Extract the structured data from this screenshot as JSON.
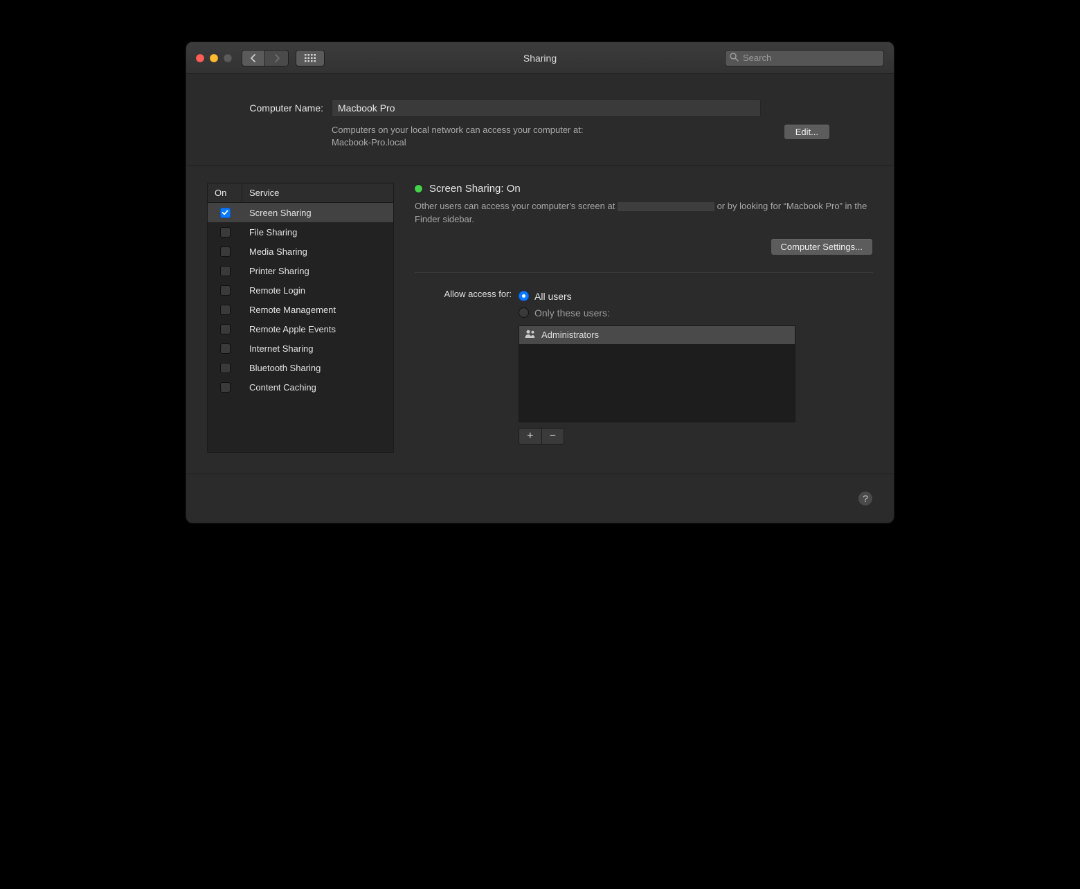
{
  "window": {
    "title": "Sharing",
    "search_placeholder": "Search"
  },
  "computer_name": {
    "label": "Computer Name:",
    "value": "Macbook Pro",
    "description_line1": "Computers on your local network can access your computer at:",
    "description_line2": "Macbook-Pro.local",
    "edit_label": "Edit..."
  },
  "services": {
    "header_on": "On",
    "header_service": "Service",
    "items": [
      {
        "name": "Screen Sharing",
        "on": true,
        "selected": true
      },
      {
        "name": "File Sharing",
        "on": false,
        "selected": false
      },
      {
        "name": "Media Sharing",
        "on": false,
        "selected": false
      },
      {
        "name": "Printer Sharing",
        "on": false,
        "selected": false
      },
      {
        "name": "Remote Login",
        "on": false,
        "selected": false
      },
      {
        "name": "Remote Management",
        "on": false,
        "selected": false
      },
      {
        "name": "Remote Apple Events",
        "on": false,
        "selected": false
      },
      {
        "name": "Internet Sharing",
        "on": false,
        "selected": false
      },
      {
        "name": "Bluetooth Sharing",
        "on": false,
        "selected": false
      },
      {
        "name": "Content Caching",
        "on": false,
        "selected": false
      }
    ]
  },
  "detail": {
    "status_title": "Screen Sharing: On",
    "status_desc_prefix": "Other users can access your computer's screen at ",
    "status_desc_suffix": " or by looking for “Macbook Pro” in the Finder sidebar.",
    "computer_settings_label": "Computer Settings...",
    "access_label": "Allow access for:",
    "option_all": "All users",
    "option_only": "Only these users:",
    "selected_option": "all",
    "users": [
      {
        "name": "Administrators"
      }
    ]
  },
  "help_label": "?"
}
